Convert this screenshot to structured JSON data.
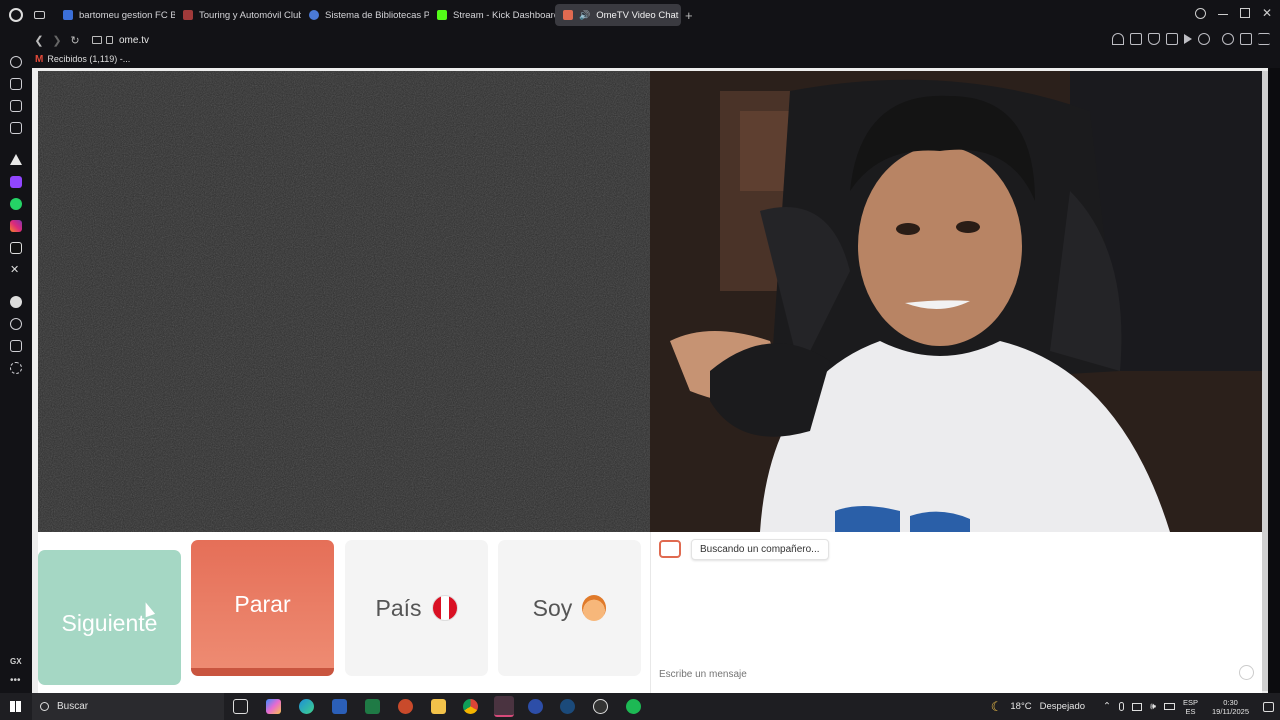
{
  "tabs": [
    {
      "label": "bartomeu gestion FC Barc",
      "color": "#3b6fd8"
    },
    {
      "label": "Touring y Automóvil Club",
      "color": "#a03a3a"
    },
    {
      "label": "Sistema de Bibliotecas PU",
      "color": "#4a7ad8"
    },
    {
      "label": "Stream - Kick Dashboard",
      "color": "#53fc18"
    },
    {
      "label": "OmeTV Video Chat -",
      "color": "#e06a50"
    }
  ],
  "address": {
    "url": "ome.tv"
  },
  "bookmarks": [
    {
      "label": "Recibidos (1,119) -..."
    }
  ],
  "controls": {
    "next_label": "Siguiente",
    "stop_label": "Parar",
    "country_label": "País",
    "gender_label": "Soy"
  },
  "chat": {
    "status": "Buscando un compañero...",
    "input_placeholder": "Escribe un mensaje"
  },
  "sidebar": {
    "gx_label": "GX"
  },
  "taskbar": {
    "search_label": "Buscar",
    "weather_temp": "18°C",
    "weather_text": "Despejado",
    "lang_top": "ESP",
    "lang_bottom": "ES",
    "time": "0:30",
    "date": "19/11/2025"
  },
  "colors": {
    "stop": "#e56f58",
    "next": "#a5d7c4",
    "brand": "#e06a50"
  }
}
